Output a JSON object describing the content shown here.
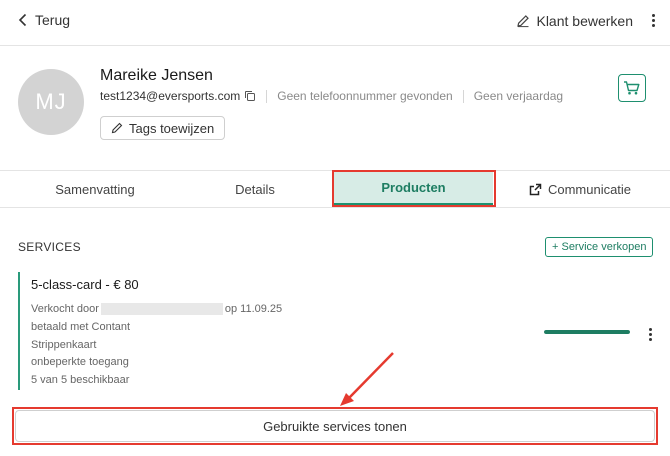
{
  "header": {
    "back_label": "Terug",
    "edit_label": "Klant bewerken"
  },
  "customer": {
    "initials": "MJ",
    "name": "Mareike Jensen",
    "email": "test1234@eversports.com",
    "phone": "Geen telefoonnummer gevonden",
    "birthday": "Geen verjaardag",
    "tags_button_label": "Tags toewijzen"
  },
  "tabs": [
    {
      "label": "Samenvatting"
    },
    {
      "label": "Details"
    },
    {
      "label": "Producten",
      "active": true
    },
    {
      "label": "Communicatie"
    }
  ],
  "services": {
    "title": "SERVICES",
    "sell_button_label": "+ Service verkopen",
    "items": [
      {
        "title": "5-class-card - € 80",
        "sold_by_prefix": "Verkocht door",
        "sold_on": "op 11.09.25",
        "payment": "betaald met Contant",
        "type": "Strippenkaart",
        "access": "onbeperkte toegang",
        "remaining": "5 van 5 beschikbaar",
        "usage_fraction": 1.0
      }
    ],
    "show_used_label": "Gebruikte services tonen"
  },
  "colors": {
    "accent": "#1e8f6f",
    "active_tab_bg": "#d7ece6",
    "highlight": "#e53a2f"
  }
}
